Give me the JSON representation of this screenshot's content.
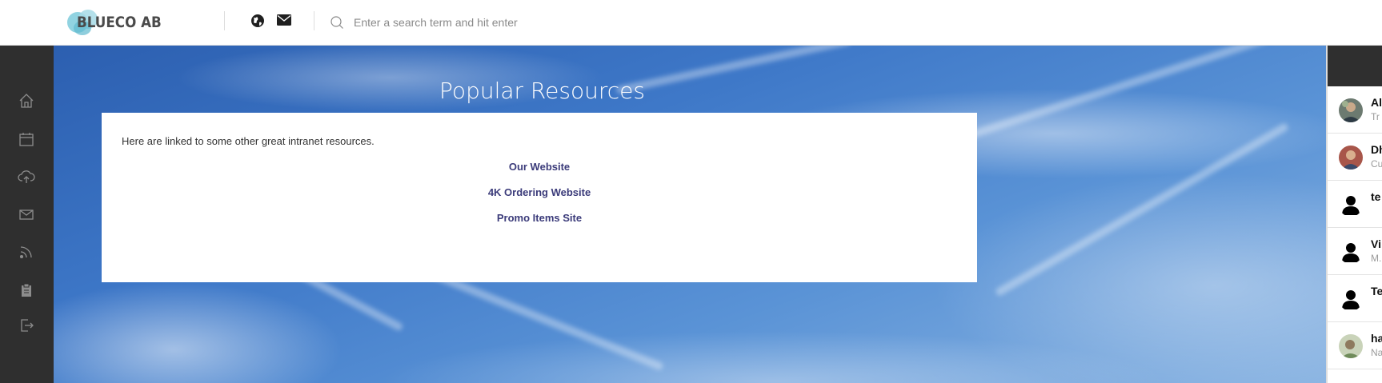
{
  "header": {
    "logo_text": "BLUECO AB",
    "globe_icon": "globe-icon",
    "mail_icon": "mail-icon",
    "search": {
      "placeholder": "Enter a search term and hit enter",
      "value": ""
    }
  },
  "sidebar": {
    "items": [
      {
        "icon": "home-icon"
      },
      {
        "icon": "calendar-icon"
      },
      {
        "icon": "cloud-upload-icon"
      },
      {
        "icon": "mail-icon"
      },
      {
        "icon": "rss-icon"
      },
      {
        "icon": "clipboard-icon"
      },
      {
        "icon": "logout-icon"
      }
    ]
  },
  "main": {
    "title": "Popular Resources",
    "intro": "Here are linked to some other great intranet resources.",
    "links": [
      "Our Website",
      "4K Ordering Website",
      "Promo Items Site"
    ]
  },
  "people": [
    {
      "name": "Al",
      "sub": "Tr",
      "avatar": "photo"
    },
    {
      "name": "Dh",
      "sub": "Cu",
      "avatar": "photo"
    },
    {
      "name": "te",
      "sub": "",
      "avatar": "default-user-icon"
    },
    {
      "name": "Vi",
      "sub": "M.",
      "avatar": "default-user-icon"
    },
    {
      "name": "Te",
      "sub": "",
      "avatar": "default-user-icon"
    },
    {
      "name": "ha",
      "sub": "Na",
      "avatar": "photo"
    }
  ],
  "colors": {
    "sidebar_bg": "#2f2f2f",
    "link_color": "#3b3b7a",
    "sky": "#3e78c8"
  }
}
